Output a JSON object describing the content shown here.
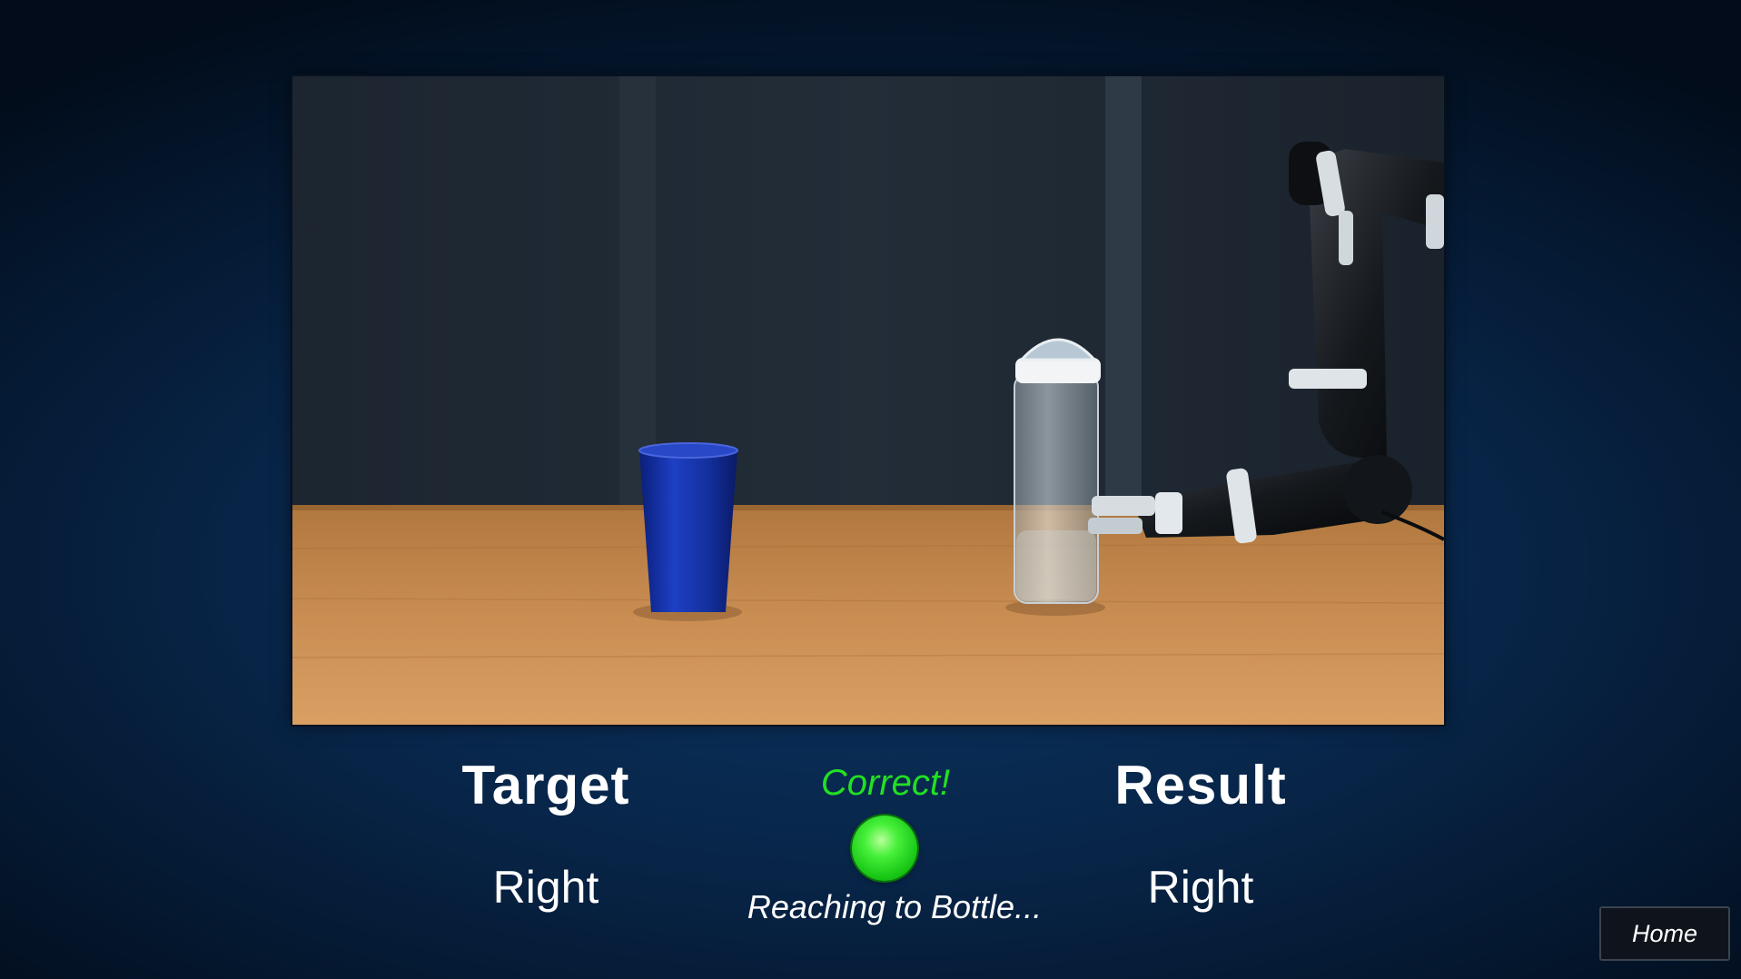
{
  "target": {
    "heading": "Target",
    "value": "Right"
  },
  "feedback": {
    "text": "Correct!",
    "color": "#22e022",
    "indicator_color": "#2fe02a"
  },
  "status": {
    "text": "Reaching to Bottle..."
  },
  "result": {
    "heading": "Result",
    "value": "Right"
  },
  "nav": {
    "home_label": "Home"
  },
  "video": {
    "scene": "robotic-arm-reaching-bottle"
  }
}
